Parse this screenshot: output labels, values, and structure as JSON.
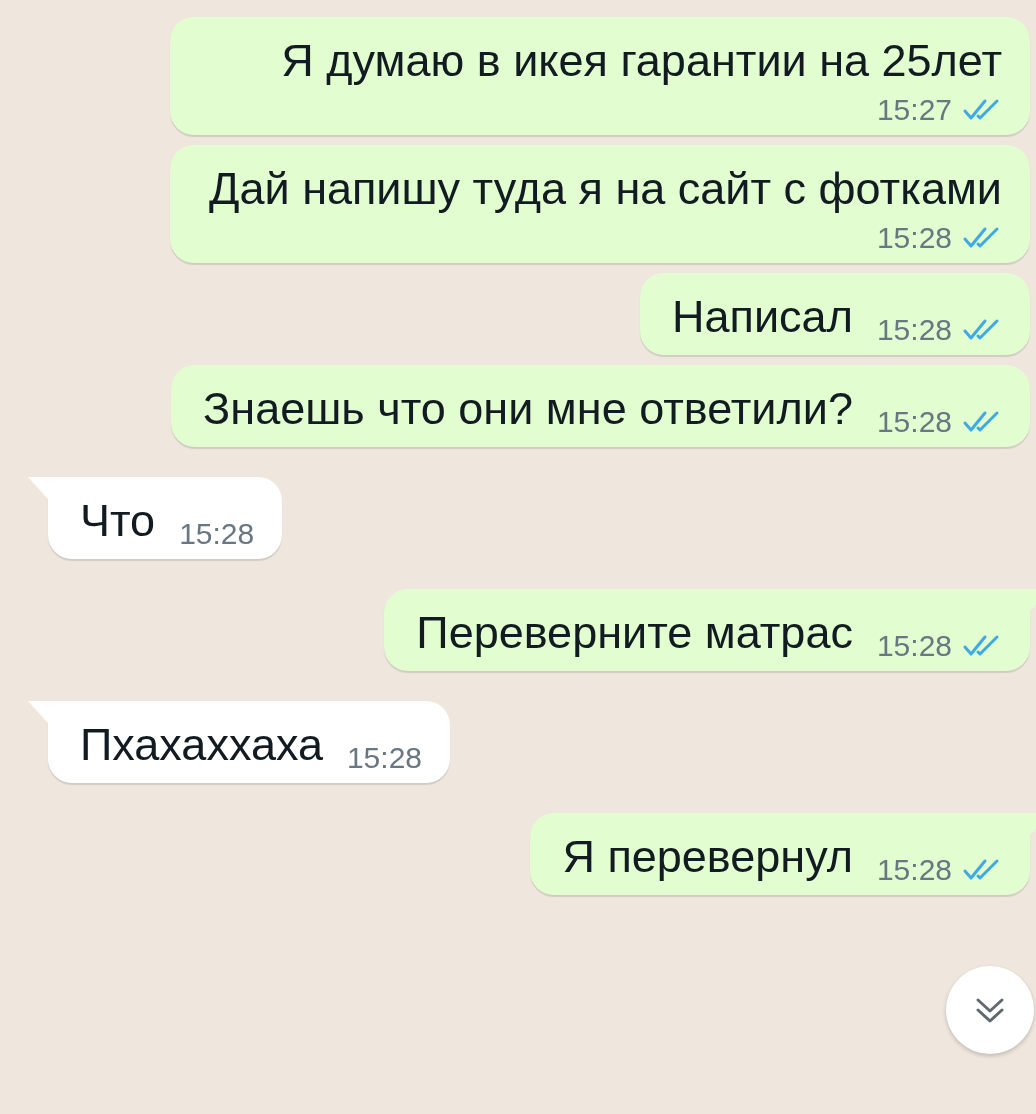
{
  "messages": [
    {
      "outgoing": true,
      "tail": false,
      "text": "Я думаю в икея гарантии на 25лет",
      "time": "15:27",
      "read": true
    },
    {
      "outgoing": true,
      "tail": false,
      "text": "Дай напишу туда я на сайт с фотками",
      "time": "15:28",
      "read": true
    },
    {
      "outgoing": true,
      "tail": false,
      "text": "Написал",
      "time": "15:28",
      "read": true
    },
    {
      "outgoing": true,
      "tail": false,
      "text": "Знаешь что они мне ответили?",
      "time": "15:28",
      "read": true
    },
    {
      "outgoing": false,
      "tail": true,
      "text": "Что",
      "time": "15:28"
    },
    {
      "outgoing": true,
      "tail": true,
      "text": "Переверните матрас",
      "time": "15:28",
      "read": true
    },
    {
      "outgoing": false,
      "tail": true,
      "text": "Пхахаххаха",
      "time": "15:28"
    },
    {
      "outgoing": true,
      "tail": true,
      "text": "Я перевернул",
      "time": "15:28",
      "read": true
    }
  ]
}
